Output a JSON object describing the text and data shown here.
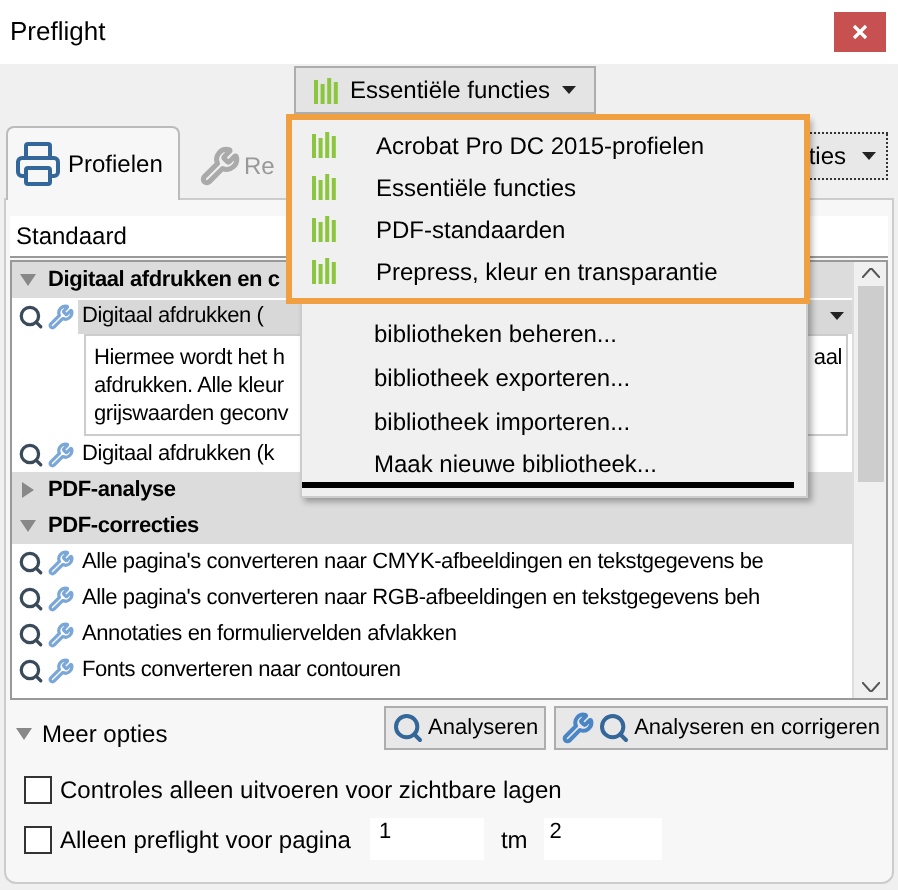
{
  "window": {
    "title": "Preflight"
  },
  "library_button": {
    "label": "Essentiële functies"
  },
  "tabs": [
    {
      "label": "Profielen",
      "kind": "profiles",
      "selected": true
    },
    {
      "label": "Re",
      "kind": "results",
      "selected": false
    }
  ],
  "options_button": {
    "label": "ties"
  },
  "profile_field": {
    "value": "Standaard"
  },
  "profile_list": {
    "groups": [
      {
        "label": "Digitaal afdrukken en c",
        "expanded": true,
        "children": [
          {
            "label": "Digitaal afdrukken (",
            "selected": true,
            "description": [
              "Hiermee wordt het h",
              "afdrukken. Alle kleur",
              "grijswaarden geconv"
            ],
            "description_tail": "aal"
          },
          {
            "label": "Digitaal afdrukken (k",
            "selected": false
          }
        ]
      },
      {
        "label": "PDF-analyse",
        "expanded": false
      },
      {
        "label": "PDF-correcties",
        "expanded": true,
        "children": [
          {
            "label": "Alle pagina's converteren naar CMYK-afbeeldingen en tekstgegevens be",
            "selected": false
          },
          {
            "label": "Alle pagina's converteren naar RGB-afbeeldingen en tekstgegevens beh",
            "selected": false
          },
          {
            "label": "Annotaties en formuliervelden afvlakken",
            "selected": false
          },
          {
            "label": "Fonts converteren naar contouren",
            "selected": false
          }
        ]
      }
    ]
  },
  "library_menu": {
    "libraries": [
      "Acrobat Pro DC 2015-profielen",
      "Essentiële functies",
      "PDF-standaarden",
      "Prepress, kleur en transparantie"
    ],
    "actions": [
      {
        "label": "bibliotheken beheren...",
        "selected": false
      },
      {
        "label": "bibliotheek exporteren...",
        "selected": false
      },
      {
        "label": "bibliotheek importeren...",
        "selected": false
      },
      {
        "label": "Maak nieuwe bibliotheek...",
        "selected": true
      }
    ]
  },
  "more_options": {
    "label": "Meer opties",
    "expanded": true
  },
  "buttons": [
    {
      "label": "Analyseren",
      "kind": "analyze"
    },
    {
      "label": "Analyseren en corrigeren",
      "kind": "fix"
    }
  ],
  "visible_layers_checkbox": {
    "label": "Controles alleen uitvoeren voor zichtbare lagen",
    "checked": false
  },
  "page_range": {
    "label": "Alleen preflight voor pagina",
    "checked": false,
    "from": "1",
    "to_label": "tm",
    "to": "2"
  }
}
